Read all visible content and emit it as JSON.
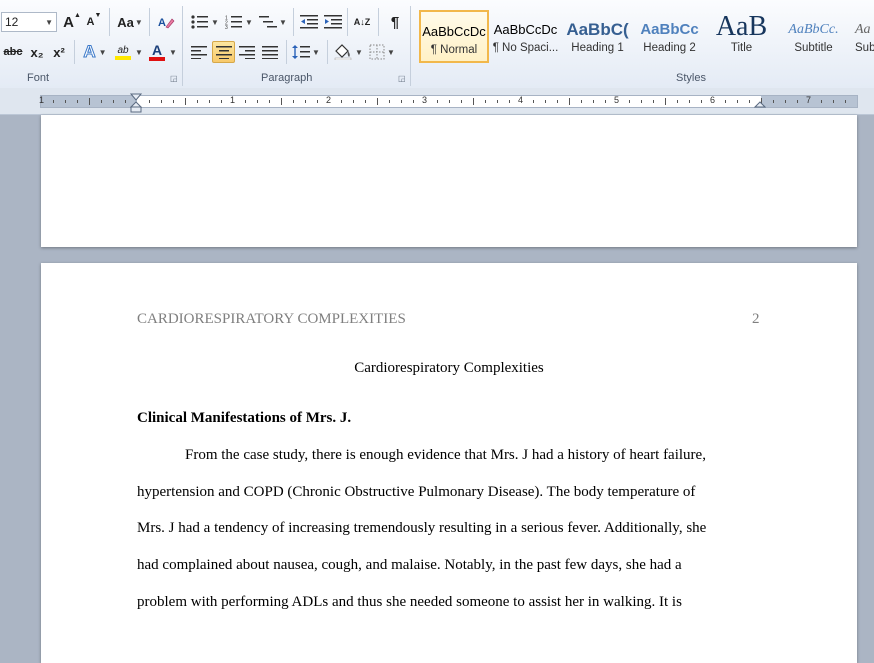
{
  "ribbon": {
    "font": {
      "size": "12",
      "group_label": "Font",
      "grow_label": "A",
      "shrink_label": "A",
      "case_label": "Aa",
      "strike_label": "abc",
      "subscript_label": "x₂",
      "superscript_label": "x²",
      "effects_label": "A",
      "highlight_label": "ab",
      "color_label": "A"
    },
    "paragraph": {
      "group_label": "Paragraph",
      "sort_label": "A↓Z",
      "pilcrow_label": "¶"
    },
    "styles": {
      "group_label": "Styles",
      "items": [
        {
          "sample": "AaBbCcDc",
          "name": "¶ Normal"
        },
        {
          "sample": "AaBbCcDc",
          "name": "¶ No Spaci..."
        },
        {
          "sample": "AaBbC(",
          "name": "Heading 1"
        },
        {
          "sample": "AaBbCc",
          "name": "Heading 2"
        },
        {
          "sample": "AaB",
          "name": "Title"
        },
        {
          "sample": "AaBbCc.",
          "name": "Subtitle"
        },
        {
          "sample": "Aa",
          "name": "Sub"
        }
      ]
    }
  },
  "ruler": {
    "numbers": [
      "1",
      "1",
      "2",
      "3",
      "4",
      "5",
      "6",
      "7"
    ]
  },
  "document": {
    "header_left": "CARDIORESPIRATORY COMPLEXITIES",
    "page_number": "2",
    "title": "Cardiorespiratory Complexities",
    "heading": "Clinical Manifestations of Mrs. J.",
    "lines": [
      "From the case study, there is enough evidence that Mrs. J had a history of heart failure,",
      "hypertension and COPD (Chronic Obstructive Pulmonary Disease). The body temperature of",
      "Mrs. J had a tendency of increasing tremendously resulting in a serious fever. Additionally, she",
      "had complained about nausea, cough, and malaise. Notably, in the past few days, she had a",
      "problem with performing ADLs and thus she needed someone to assist her in walking. It is"
    ]
  },
  "colors": {
    "highlight": "#ffe800",
    "font_color": "#e01010",
    "header_text": "#7f7f7f",
    "heading_blue": "#365f91"
  }
}
